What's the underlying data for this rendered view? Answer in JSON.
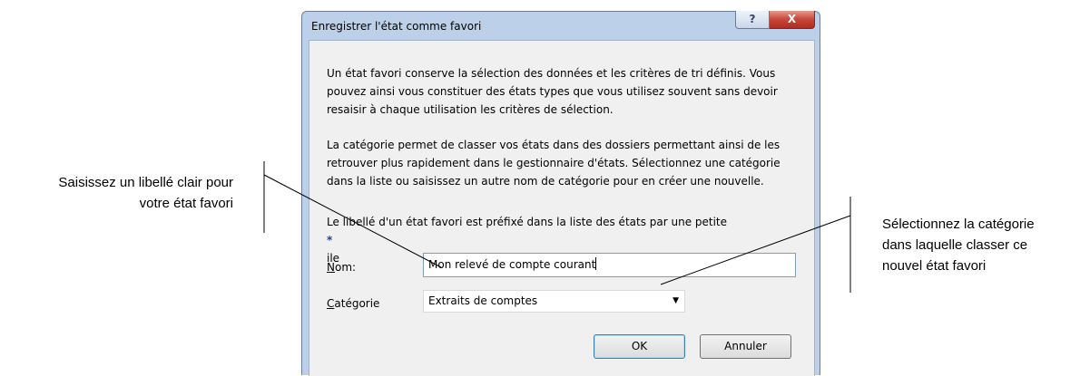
{
  "dialog": {
    "title": "Enregistrer l'état comme favori",
    "help_glyph": "?",
    "close_glyph": "X",
    "intro_lines": [
      "Un état favori conserve la sélection des données et les critères de tri définis. Vous",
      "pouvez ainsi vous constituer des états types que vous utilisez souvent sans devoir",
      "resaisir à chaque utilisation les critères de sélection."
    ],
    "category_lines": [
      "La catégorie permet de classer vos états dans des dossiers permettant ainsi de les",
      "retrouver plus rapidement dans le gestionnaire d'états. Sélectionnez une catégorie",
      "dans la liste ou saisissez un autre nom de catégorie pour en créer une nouvelle."
    ],
    "prefix_note_start": "Le libellé d'un état favori est préfixé dans la liste des états par une petite",
    "prefix_star": "*",
    "prefix_note_end": "ile",
    "name_label_key": "N",
    "name_label_rest": "om:",
    "name_value": "Mon relevé de compte courant",
    "category_label_key": "C",
    "category_label_rest": "atégorie",
    "category_value": "Extraits de comptes",
    "category_arrow": "▼",
    "ok_label": "OK",
    "cancel_label": "Annuler"
  },
  "callouts": {
    "left_lines": [
      "Saisissez un libellé clair pour",
      "votre état favori"
    ],
    "right_lines": [
      "Sélectionnez la catégorie",
      "dans laquelle classer ce",
      "nouvel état favori"
    ]
  },
  "colors": {
    "frame": "#bcd1e9",
    "client": "#f0f0f0",
    "close_button": "#c7463a",
    "star": "#1b41a8"
  }
}
